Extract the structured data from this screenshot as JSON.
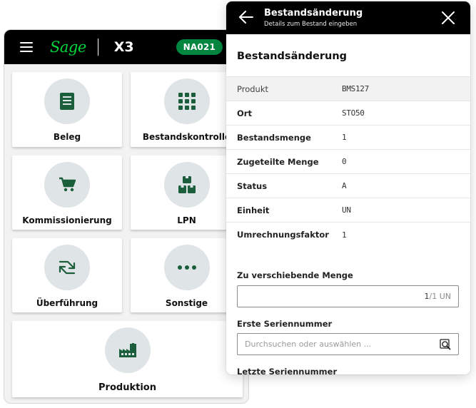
{
  "menu": {
    "brand": "Sage",
    "product": "X3",
    "site_badge": "NA021",
    "tiles": [
      {
        "label": "Beleg",
        "icon": "document-icon"
      },
      {
        "label": "Bestandskontrolle",
        "icon": "grid-icon"
      },
      {
        "label": "Kommissionierung",
        "icon": "cart-icon"
      },
      {
        "label": "LPN",
        "icon": "stacked-boxes-icon"
      },
      {
        "label": "Überführung",
        "icon": "transfer-arrows-icon"
      },
      {
        "label": "Sonstige",
        "icon": "more-dots-icon"
      },
      {
        "label": "Produktion",
        "icon": "factory-icon"
      }
    ]
  },
  "detail": {
    "header_title": "Bestandsänderung",
    "header_subtitle": "Details zum Bestand eingeben",
    "section_title": "Bestandsänderung",
    "rows": [
      {
        "label": "Produkt",
        "value": "BMS127"
      },
      {
        "label": "Ort",
        "value": "STO50"
      },
      {
        "label": "Bestandsmenge",
        "value": "1"
      },
      {
        "label": "Zugeteilte Menge",
        "value": "0"
      },
      {
        "label": "Status",
        "value": "A"
      },
      {
        "label": "Einheit",
        "value": "UN"
      },
      {
        "label": "Umrechnungsfaktor",
        "value": "1"
      }
    ],
    "qty_label": "Zu verschiebende Menge",
    "qty_value": "1",
    "qty_unit": "/1 UN",
    "first_serial_label": "Erste Seriennummer",
    "first_serial_placeholder": "Durchsuchen oder auswählen ...",
    "last_serial_label": "Letzte Seriennummer"
  },
  "colors": {
    "brand_green": "#00d639",
    "badge_green": "#00863f",
    "icon_green": "#1b5e3b",
    "icon_circle": "#dfe4e6"
  }
}
